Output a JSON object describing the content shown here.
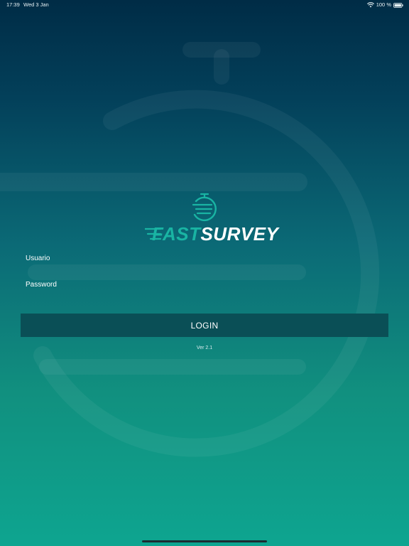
{
  "status_bar": {
    "time": "17:39",
    "date": "Wed 3 Jan",
    "battery": "100 %"
  },
  "logo": {
    "text_fast": "FAST",
    "text_survey": "SURVEY",
    "icon": "stopwatch-icon",
    "colors": {
      "accent": "#19b4a3",
      "text": "#ffffff"
    }
  },
  "form": {
    "username_label": "Usuario",
    "username_value": "",
    "password_label": "Password",
    "password_value": "",
    "login_label": "LOGIN"
  },
  "version": "Ver 2.1",
  "colors": {
    "background_top": "#002c46",
    "background_bottom": "#0ea590",
    "button": "#0a4f56"
  }
}
